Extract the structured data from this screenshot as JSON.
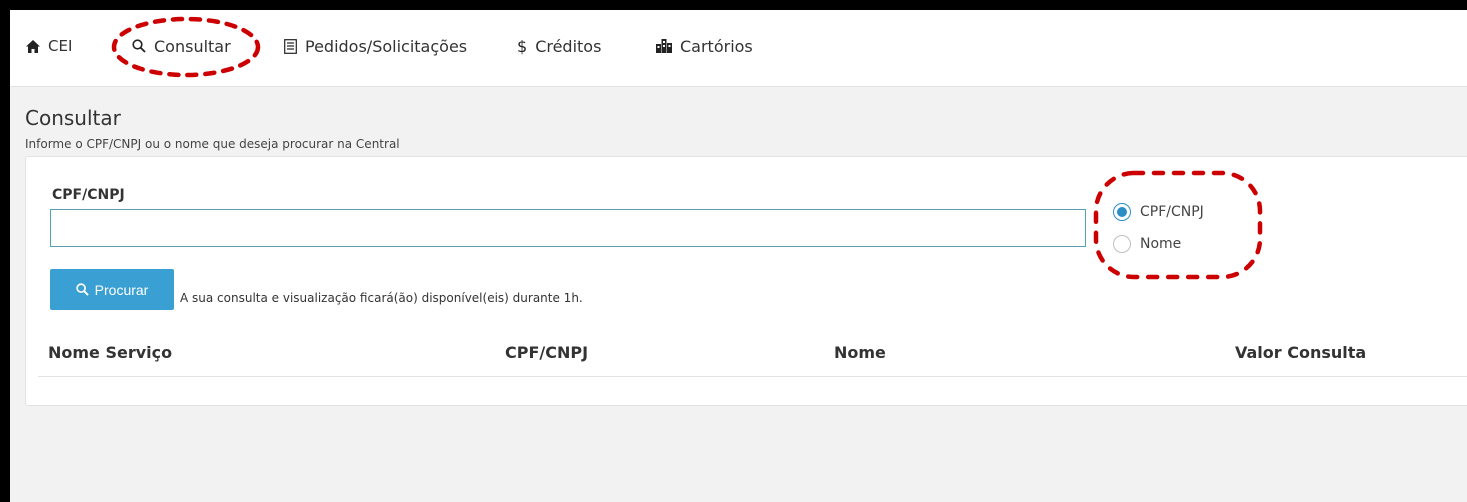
{
  "nav": {
    "items": [
      {
        "label": "CEI",
        "icon": "home-icon"
      },
      {
        "label": "Consultar",
        "icon": "search-icon"
      },
      {
        "label": "Pedidos/Solicitações",
        "icon": "document-list-icon"
      },
      {
        "label": "Créditos",
        "icon": "dollar-icon"
      },
      {
        "label": "Cartórios",
        "icon": "buildings-icon"
      }
    ]
  },
  "page": {
    "title": "Consultar",
    "subtitle": "Informe o CPF/CNPJ ou o nome que deseja procurar na Central"
  },
  "form": {
    "field_label": "CPF/CNPJ",
    "input_value": "",
    "radio_options": [
      {
        "label": "CPF/CNPJ",
        "checked": true
      },
      {
        "label": "Nome",
        "checked": false
      }
    ],
    "search_button": "Procurar",
    "hint": "A sua consulta e visualização ficará(ão) disponível(eis) durante 1h."
  },
  "table": {
    "headers": [
      "Nome Serviço",
      "CPF/CNPJ",
      "Nome",
      "Valor Consulta"
    ]
  },
  "colors": {
    "accent": "#3a9fd3",
    "annotation": "#cc0000"
  }
}
